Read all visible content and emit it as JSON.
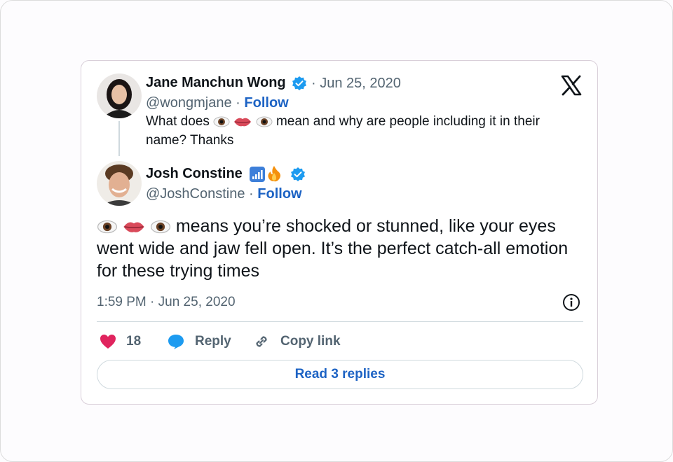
{
  "embed": {
    "parent_tweet": {
      "author_name": "Jane Manchun Wong",
      "verified_icon": "verified-badge-icon",
      "date_separator": "·",
      "date": "Jun 25, 2020",
      "handle": "@wongmjane",
      "follow_separator": "·",
      "follow_label": "Follow",
      "text_before": "What does",
      "text_emojis": [
        "eye-emoji",
        "lips-emoji",
        "eye-emoji"
      ],
      "text_after": "mean and why are people including it in their name? Thanks"
    },
    "tweet": {
      "author_name": "Josh Constine",
      "name_emojis": [
        "antenna-bars-emoji",
        "fire-emoji"
      ],
      "verified_icon": "verified-badge-icon",
      "handle": "@JoshConstine",
      "follow_separator": "·",
      "follow_label": "Follow",
      "text_emojis": [
        "eye-emoji",
        "lips-emoji",
        "eye-emoji"
      ],
      "text_after": "means you’re shocked or stunned, like your eyes went wide and jaw fell open. It’s the perfect catch-all emotion for these trying times",
      "timestamp": "1:59 PM · Jun 25, 2020"
    },
    "actions": {
      "like_count": "18",
      "reply_label": "Reply",
      "copy_label": "Copy link"
    },
    "read_replies_label": "Read 3 replies",
    "colors": {
      "accent": "#1d63c4",
      "verified": "#1d9bf0",
      "heart": "#e0245e",
      "muted": "#536471"
    }
  }
}
